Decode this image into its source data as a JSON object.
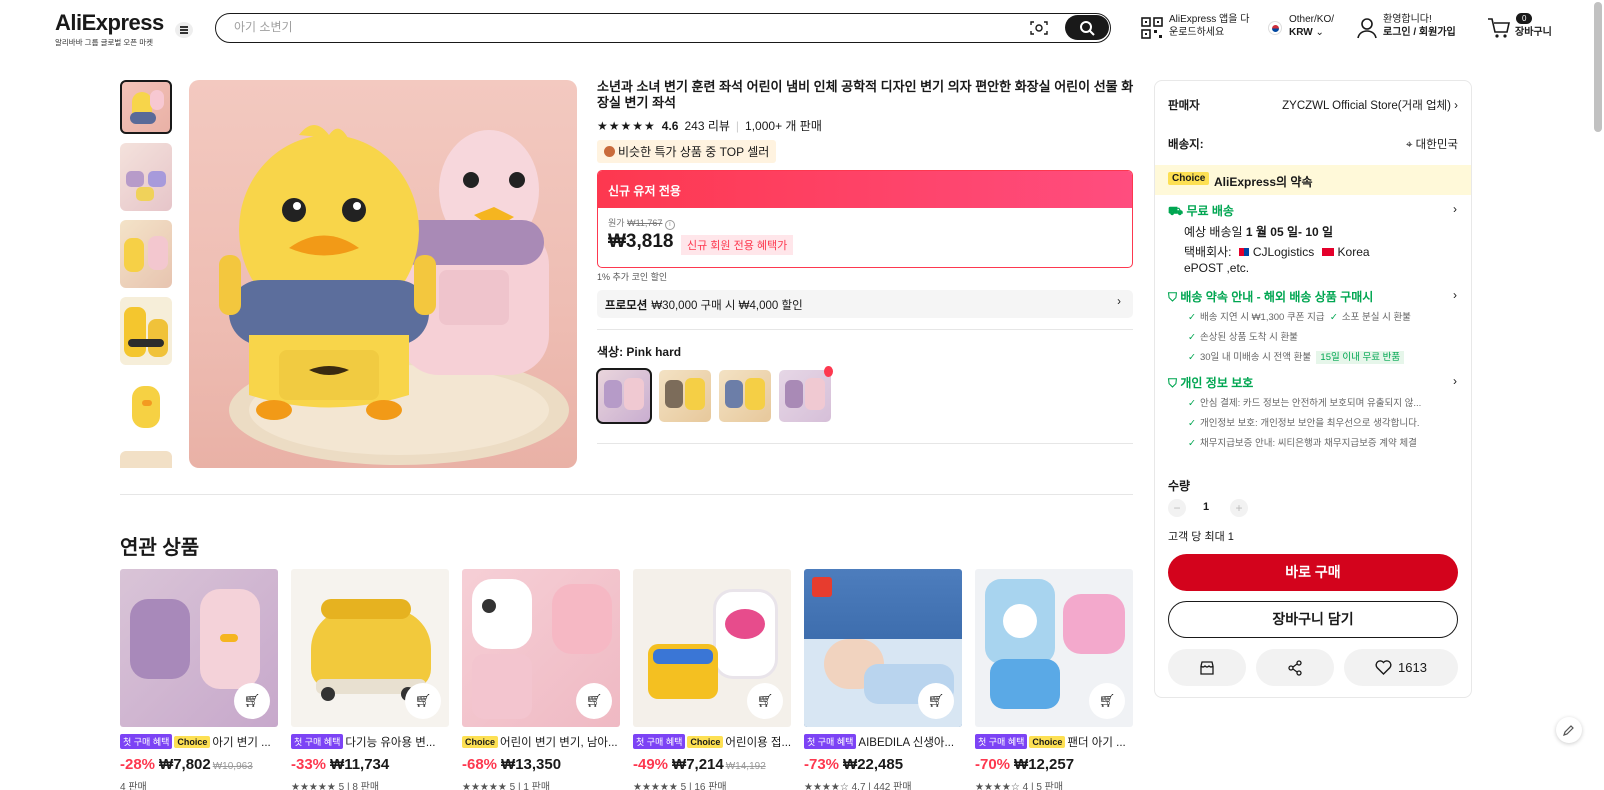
{
  "header": {
    "logo": "AliExpress",
    "logo_sub": "알리바바 그룹 글로벌 오픈 마켓",
    "search_placeholder": "아기 소변기",
    "app_line1": "AliExpress 앱을 다",
    "app_line2": "운로드하세요",
    "locale_line1": "Other/KO/",
    "locale_line2": "KRW",
    "account_line1": "환영합니다!",
    "account_line2": "로그인 / 회원가입",
    "cart_count": "0",
    "cart_label": "장바구니"
  },
  "product": {
    "title": "소년과 소녀 변기 훈련 좌석 어린이 냄비 인체 공학적 디자인 변기 의자 편안한 화장실 어린이 선물 화장실 변기 좌석",
    "rating": "4.6",
    "reviews": "243 리뷰",
    "sold": "1,000+ 개 판매",
    "top_badge": "비슷한 특가 상품 중 TOP 셀러",
    "new_user_label": "신규 유저 전용",
    "orig_label": "원가",
    "orig_price": "₩11,767",
    "price": "₩3,818",
    "price_tag": "신규 회원 전용 혜택가",
    "coin_note": "1% 추가 코인 할인",
    "promo_label": "프로모션",
    "promo_text": "₩30,000 구매 시 ₩4,000 할인",
    "color_label": "색상:",
    "color_value": "Pink hard"
  },
  "panel": {
    "seller_label": "판매자",
    "seller_value": "ZYCZWL Official Store(거래 업체)",
    "ship_label": "배송지:",
    "ship_value": "대한민국",
    "choice_tag": "Choice",
    "choice_text": "AliExpress의 약속",
    "free_ship": "무료 배송",
    "eta_prefix": "예상 배송일",
    "eta_value": "1 월 05 일- 10 일",
    "carrier_label": "택배회사:",
    "carrier_1": "CJLogistics",
    "carrier_2": "Korea",
    "carrier_3": "ePOST ,etc.",
    "guarantee_title": "배송 약속 안내 - 해외 배송 상품 구매시",
    "g1a": "배송 지연 시 ₩1,300 쿠폰 지급",
    "g1b": "소포 분실 시 환불",
    "g2": "손상된 상품 도착 시 환불",
    "g3": "30일 내 미배송 시 전액 환불",
    "g3_pill": "15일 이내 무료 반품",
    "privacy_title": "개인 정보 보호",
    "p1": "안심 결제: 카드 정보는 안전하게 보호되며 유출되지 않...",
    "p2": "개인정보 보호: 개인정보 보안을 최우선으로 생각합니다.",
    "p3": "채무지급보증 안내: 씨티은행과 채무지급보증 계약 체결",
    "qty_label": "수량",
    "qty_value": "1",
    "limit": "고객 당 최대 1",
    "buy_now": "바로 구매",
    "add_cart": "장바구니 담기",
    "wishlist": "1613"
  },
  "related": {
    "title": "연관 상품",
    "items": [
      {
        "tag1": "첫 구매 혜택",
        "tag2": "Choice",
        "name": "아기 변기 ...",
        "disc": "-28%",
        "price": "₩7,802",
        "orig": "₩10,963",
        "meta": "4 판매"
      },
      {
        "tag1": "첫 구매 혜택",
        "tag2": "",
        "name": "다기능 유아용 변...",
        "disc": "-33%",
        "price": "₩11,734",
        "orig": "",
        "meta": "★★★★★ 5 | 8 판매"
      },
      {
        "tag1": "",
        "tag2": "Choice",
        "name": "어린이 변기 변기, 남아...",
        "disc": "-68%",
        "price": "₩13,350",
        "orig": "",
        "meta": "★★★★★ 5 | 1 판매"
      },
      {
        "tag1": "첫 구매 혜택",
        "tag2": "Choice",
        "name": "어린이용 접...",
        "disc": "-49%",
        "price": "₩7,214",
        "orig": "₩14,192",
        "meta": "★★★★★ 5 | 16 판매"
      },
      {
        "tag1": "첫 구매 혜택",
        "tag2": "",
        "name": "AIBEDILA 신생아...",
        "disc": "-73%",
        "price": "₩22,485",
        "orig": "",
        "meta": "★★★★☆ 4.7 | 442 판매"
      },
      {
        "tag1": "첫 구매 혜택",
        "tag2": "Choice",
        "name": "팬더 아기 ...",
        "disc": "-70%",
        "price": "₩12,257",
        "orig": "",
        "meta": "★★★★☆ 4 | 5 판매"
      }
    ]
  }
}
